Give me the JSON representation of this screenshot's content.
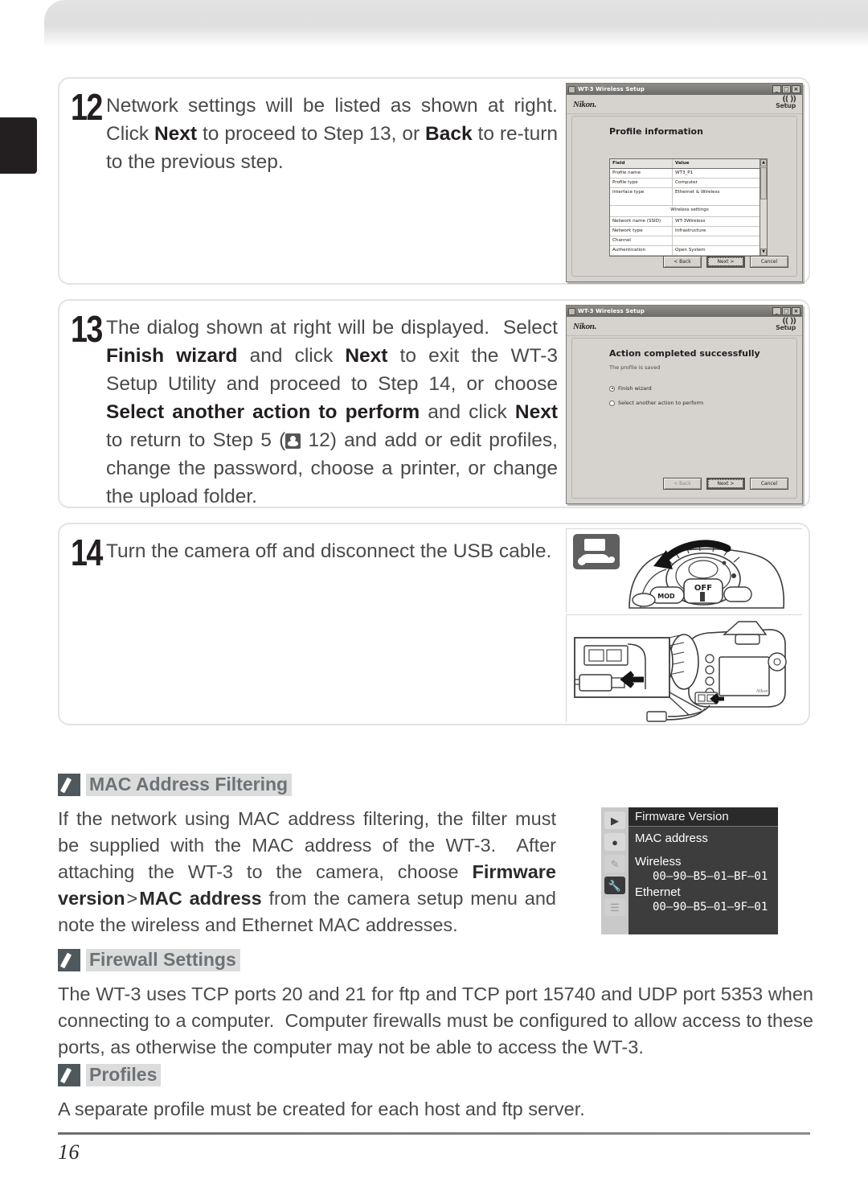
{
  "page": {
    "number": "16",
    "tab_color": "#231f20"
  },
  "steps": [
    {
      "number": "12",
      "text_html": "Network settings will be listed as shown at right. Click <b>Next</b> to proceed to Step 13, or <b>Back</b> to re-turn to the previous step.",
      "text_plain": "Network settings will be listed as shown at right. Click Next to proceed to Step 13, or Back to return to the previous step."
    },
    {
      "number": "13",
      "text_plain": "The dialog shown at right will be displayed. Select Finish wizard and click Next to exit the WT-3 Setup Utility and proceed to Step 14, or choose Select another action to perform and click Next to return to Step 5 (12) and add or edit profiles, change the password, choose a printer, or change the upload folder."
    },
    {
      "number": "14",
      "text_plain": "Turn the camera off and disconnect the USB cable."
    }
  ],
  "dialog_profile": {
    "titlebar": "WT-3 Wireless Setup",
    "brand": "Nikon.",
    "logo_wave": "(( ))",
    "logo_word": "Setup",
    "heading": "Profile information",
    "table": {
      "headers": [
        "Field",
        "Value"
      ],
      "rows": [
        {
          "field": "Profile name",
          "value": "WT3_P1"
        },
        {
          "field": "Profile type",
          "value": "Computer"
        },
        {
          "field": "Interface type",
          "value": "Ethernet & Wireless"
        },
        {
          "section": "Wireless settings"
        },
        {
          "field": "Network name (SSID)",
          "value": "WT-3Wireless"
        },
        {
          "field": "Network type",
          "value": "Infrastructure"
        },
        {
          "field": "Channel",
          "value": ""
        },
        {
          "field": "Authentication",
          "value": "Open System"
        }
      ]
    },
    "buttons": {
      "back": "< Back",
      "next": "Next >",
      "cancel": "Cancel"
    },
    "window_controls": {
      "minimize": "_",
      "maximize": "□",
      "close": "×"
    }
  },
  "dialog_finish": {
    "titlebar": "WT-3 Wireless Setup",
    "brand": "Nikon.",
    "logo_wave": "(( ))",
    "logo_word": "Setup",
    "heading": "Action completed successfully",
    "subtext": "The profile is saved",
    "options": [
      {
        "label": "Finish wizard",
        "selected": true
      },
      {
        "label": "Select another action to perform",
        "selected": false
      }
    ],
    "buttons": {
      "back": "< Back",
      "next": "Next >",
      "cancel": "Cancel"
    },
    "window_controls": {
      "minimize": "_",
      "maximize": "□",
      "close": "×"
    }
  },
  "notes": [
    {
      "title": "MAC Address Filtering",
      "body_plain": "If the network using MAC address filtering, the filter must be supplied with the MAC address of the WT-3.  After attaching the WT-3 to the camera, choose Firmware version > MAC address from the camera setup menu and note the wireless and Ethernet MAC addresses."
    },
    {
      "title": "Firewall Settings",
      "body_plain": "The WT-3 uses TCP ports 20 and 21 for ftp and TCP port 15740 and UDP port 5353 when connecting to a computer.  Computer firewalls must be configured to allow access to these ports, as otherwise the computer may not be able to access the WT-3."
    },
    {
      "title": "Profiles",
      "body_plain": "A separate profile must be created for each host and ftp server."
    }
  ],
  "camera_menu": {
    "title": "Firmware Version",
    "section_label": "MAC address",
    "entries": [
      {
        "label": "Wireless",
        "value": "00–90–B5–01–BF–01"
      },
      {
        "label": "Ethernet",
        "value": "00–90–B5–01–9F–01"
      }
    ],
    "icons": [
      "playback-icon",
      "shooting-menu-icon",
      "custom-settings-icon",
      "setup-menu-icon",
      "recent-settings-icon"
    ],
    "selected_icon": "setup-menu-icon"
  },
  "illustrations": [
    {
      "name": "camera-power-switch-off",
      "caption": ""
    },
    {
      "name": "camera-usb-disconnect",
      "caption": ""
    }
  ]
}
